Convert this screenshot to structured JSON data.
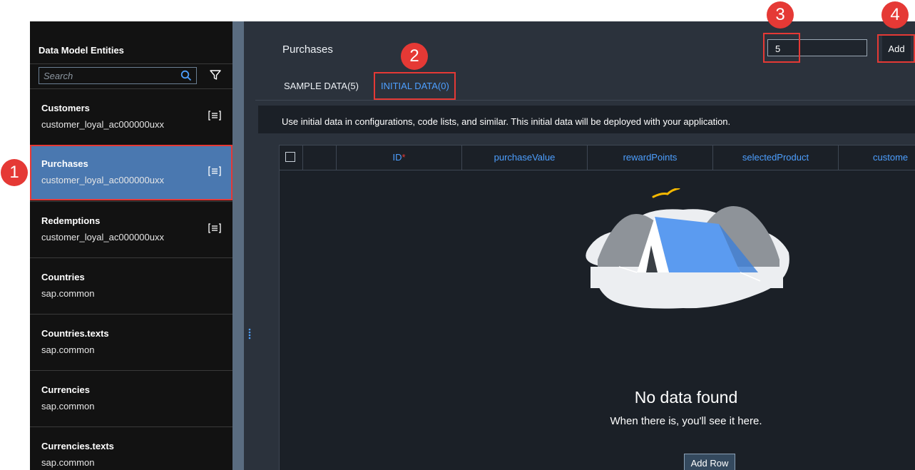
{
  "sidebar": {
    "title": "Data Model Entities",
    "search_placeholder": "Search",
    "items": [
      {
        "name": "Customers",
        "namespace": "customer_loyal_ac000000uxx"
      },
      {
        "name": "Purchases",
        "namespace": "customer_loyal_ac000000uxx",
        "selected": true
      },
      {
        "name": "Redemptions",
        "namespace": "customer_loyal_ac000000uxx"
      },
      {
        "name": "Countries",
        "namespace": "sap.common"
      },
      {
        "name": "Countries.texts",
        "namespace": "sap.common"
      },
      {
        "name": "Currencies",
        "namespace": "sap.common"
      },
      {
        "name": "Currencies.texts",
        "namespace": "sap.common"
      }
    ]
  },
  "main": {
    "entity_title": "Purchases",
    "row_count_value": "5",
    "add_label": "Add",
    "tabs": [
      {
        "label": "SAMPLE DATA(5)"
      },
      {
        "label": "INITIAL DATA(0)",
        "active": true
      }
    ],
    "info_text": "Use initial data in configurations, code lists, and similar. This initial data will be deployed with your application.",
    "columns": [
      {
        "label": "ID",
        "required": true
      },
      {
        "label": "purchaseValue"
      },
      {
        "label": "rewardPoints"
      },
      {
        "label": "selectedProduct"
      },
      {
        "label": "custome"
      }
    ],
    "required_marker": "*",
    "empty_title": "No data found",
    "empty_subtitle": "When there is, you'll see it here.",
    "add_row_label": "Add Row"
  },
  "callouts": [
    "1",
    "2",
    "3",
    "4"
  ],
  "colors": {
    "accent": "#4d9fff",
    "callout": "#e53935",
    "selected": "#4a78b0"
  }
}
